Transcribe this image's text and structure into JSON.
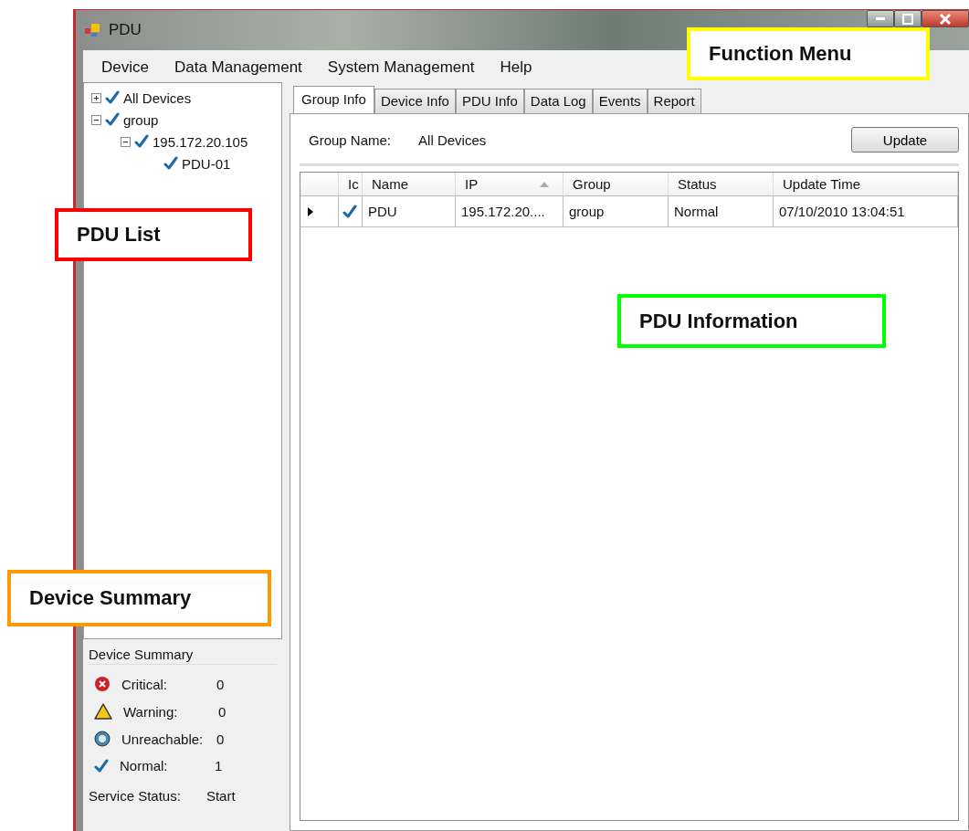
{
  "window": {
    "title": "PDU"
  },
  "menu": [
    "Device",
    "Data Management",
    "System Management",
    "Help"
  ],
  "tree": [
    {
      "label": "All Devices",
      "checked": true,
      "expanded": false
    },
    {
      "label": "group",
      "checked": true,
      "expanded": true,
      "children": [
        {
          "label": "195.172.20.105",
          "checked": true,
          "expanded": true,
          "children": [
            {
              "label": "PDU-01",
              "checked": true
            }
          ]
        }
      ]
    }
  ],
  "summary": {
    "title": "Device Summary",
    "items": [
      {
        "kind": "critical",
        "label": "Critical:",
        "value": "0"
      },
      {
        "kind": "warning",
        "label": "Warning:",
        "value": "0"
      },
      {
        "kind": "unreachable",
        "label": "Unreachable:",
        "value": "0"
      },
      {
        "kind": "normal",
        "label": "Normal:",
        "value": "1"
      }
    ],
    "service_label": "Service Status:",
    "service_value": "Start"
  },
  "tabs": [
    {
      "label": "Group Info",
      "selected": true
    },
    {
      "label": "Device Info",
      "selected": false
    },
    {
      "label": "PDU Info",
      "selected": false
    },
    {
      "label": "Data Log",
      "selected": false
    },
    {
      "label": "Events",
      "selected": false
    },
    {
      "label": "Report",
      "selected": false
    }
  ],
  "group_name": {
    "label": "Group Name:",
    "value": "All Devices"
  },
  "update_button": "Update",
  "table": {
    "columns": [
      {
        "label": "Ic"
      },
      {
        "label": "Name"
      },
      {
        "label": "IP",
        "sorted": true
      },
      {
        "label": "Group"
      },
      {
        "label": "Status"
      },
      {
        "label": "Update Time"
      }
    ],
    "rows": [
      {
        "current": true,
        "checked": true,
        "cells": [
          "",
          "PDU",
          "195.172.20....",
          "group",
          "Normal",
          "07/10/2010 13:04:51"
        ]
      }
    ]
  },
  "callouts": [
    {
      "label": "Function Menu",
      "color": "#ffff00"
    },
    {
      "label": "PDU List",
      "color": "#ff0000"
    },
    {
      "label": "PDU Information",
      "color": "#00ff00"
    },
    {
      "label": "Device Summary",
      "color": "#ff9900"
    }
  ]
}
